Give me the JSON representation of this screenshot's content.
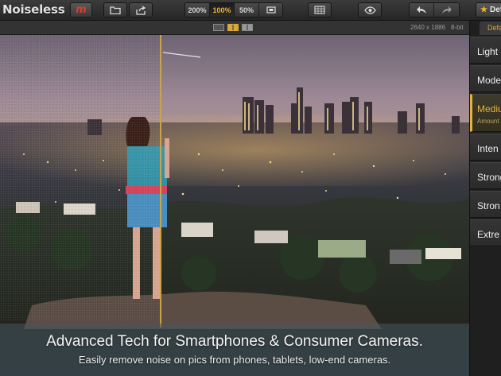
{
  "app": {
    "title": "Noiseless"
  },
  "toolbar": {
    "zoom_levels": [
      "200%",
      "100%",
      "50%"
    ],
    "active_zoom": "100%",
    "presets_label": "Defa"
  },
  "infobar": {
    "image_size": "2640 x 1886",
    "bit_depth": "8-bit"
  },
  "presets": {
    "items": [
      "Light",
      "Mode",
      "Mediu",
      "Inten",
      "Strong",
      "Stron",
      "Extre"
    ],
    "active_sub": "Amount"
  },
  "caption": {
    "headline": "Advanced Tech for Smartphones & Consumer Cameras.",
    "subline": "Easily remove noise on pics from phones, tablets, low-end cameras."
  },
  "colors": {
    "accent": "#e3b33b",
    "logo": "#e23a2c",
    "toolbar": "#2e2e2e"
  },
  "icons": [
    "open-folder-icon",
    "share-icon",
    "fit-screen-icon",
    "grid-icon",
    "eye-icon",
    "undo-icon",
    "redo-icon",
    "star-icon"
  ]
}
